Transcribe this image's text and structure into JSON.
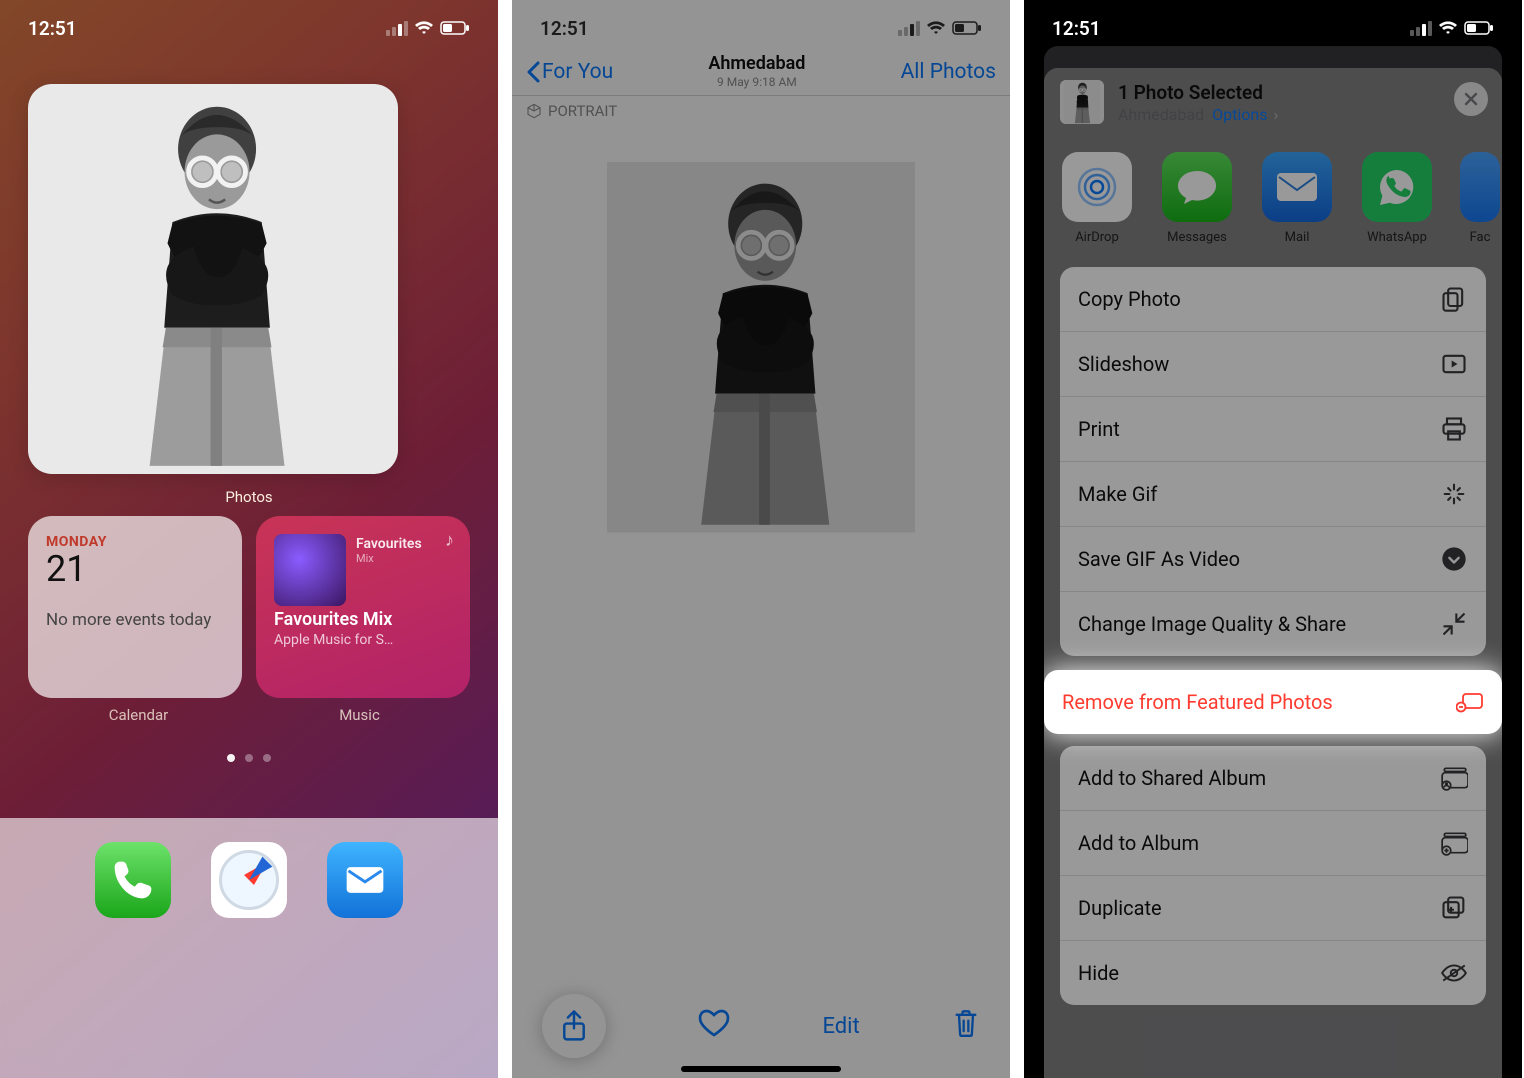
{
  "status": {
    "time": "12:51"
  },
  "home": {
    "photos_label": "Photos",
    "calendar": {
      "day": "MONDAY",
      "date": "21",
      "message": "No more events today",
      "app_label": "Calendar"
    },
    "music": {
      "hdr": "Favourites",
      "hdr_sub": "Mix",
      "title": "Favourites Mix",
      "subtitle": "Apple Music for S…",
      "app_label": "Music"
    },
    "dock": {
      "phone": "Phone",
      "safari": "Safari",
      "mail": "Mail"
    }
  },
  "photos": {
    "back": "For You",
    "location": "Ahmedabad",
    "datetime": "9 May  9:18 AM",
    "all": "All Photos",
    "badge": "PORTRAIT",
    "toolbar": {
      "share": "Share",
      "fav": "Favorite",
      "edit": "Edit",
      "trash": "Delete"
    }
  },
  "share": {
    "count_title": "1 Photo Selected",
    "location": "Ahmedabad",
    "options": "Options",
    "targets": [
      {
        "key": "airdrop",
        "label": "AirDrop"
      },
      {
        "key": "messages",
        "label": "Messages"
      },
      {
        "key": "mail",
        "label": "Mail"
      },
      {
        "key": "whatsapp",
        "label": "WhatsApp"
      },
      {
        "key": "facebook",
        "label": "Fac"
      }
    ],
    "actions_a": [
      {
        "key": "copy",
        "label": "Copy Photo"
      },
      {
        "key": "slideshow",
        "label": "Slideshow"
      },
      {
        "key": "print",
        "label": "Print"
      },
      {
        "key": "makegif",
        "label": "Make Gif"
      },
      {
        "key": "savegif",
        "label": "Save GIF As Video"
      },
      {
        "key": "ciq",
        "label": "Change Image Quality & Share"
      }
    ],
    "highlight": {
      "label": "Remove from Featured Photos"
    },
    "actions_b": [
      {
        "key": "shared",
        "label": "Add to Shared Album"
      },
      {
        "key": "album",
        "label": "Add to Album"
      },
      {
        "key": "duplicate",
        "label": "Duplicate"
      },
      {
        "key": "hide",
        "label": "Hide"
      }
    ]
  }
}
